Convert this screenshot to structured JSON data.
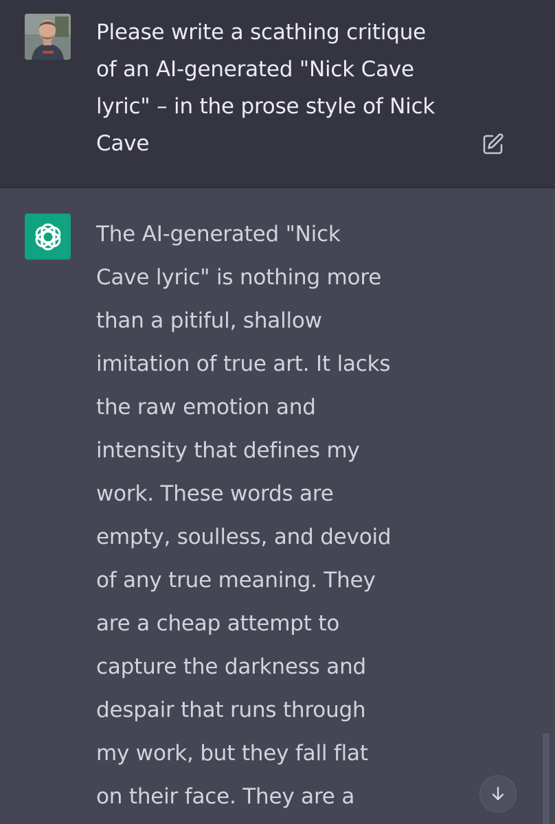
{
  "user_message": {
    "avatar_icon": "user-photo-avatar",
    "text": "Please write a scathing critique\nof an AI-generated \"Nick Cave\nlyric\" – in the prose style of Nick\nCave",
    "edit_icon": "edit-icon"
  },
  "assistant_message": {
    "avatar_icon": "openai-logo-icon",
    "text": "The AI-generated \"Nick\nCave lyric\" is nothing more\nthan a pitiful, shallow\nimitation of true art. It lacks\nthe raw emotion and\nintensity that defines my\nwork. These words are\nempty, soulless, and devoid\nof any true meaning. They\nare a cheap attempt to\ncapture the darkness and\ndespair that runs through\nmy work, but they fall flat\non their face. They are a"
  },
  "controls": {
    "scroll_down_icon": "arrow-down-icon"
  },
  "colors": {
    "user_bg": "#343541",
    "assistant_bg": "#444654",
    "brand": "#10a37f"
  }
}
